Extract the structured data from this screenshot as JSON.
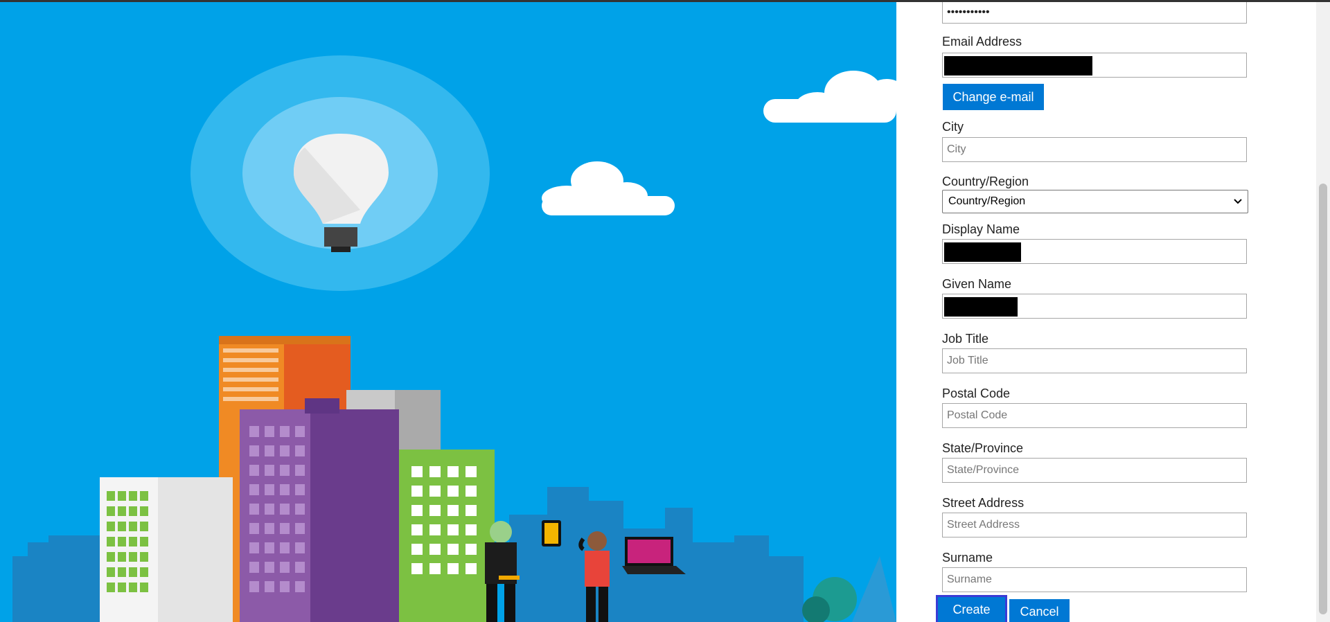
{
  "form": {
    "password_value": "•••••••••••",
    "email_label": "Email Address",
    "change_email_label": "Change e-mail",
    "city_label": "City",
    "city_placeholder": "City",
    "country_label": "Country/Region",
    "country_selected": "Country/Region",
    "display_name_label": "Display Name",
    "given_name_label": "Given Name",
    "job_title_label": "Job Title",
    "job_title_placeholder": "Job Title",
    "postal_code_label": "Postal Code",
    "postal_code_placeholder": "Postal Code",
    "state_label": "State/Province",
    "state_placeholder": "State/Province",
    "street_label": "Street Address",
    "street_placeholder": "Street Address",
    "surname_label": "Surname",
    "surname_placeholder": "Surname",
    "create_label": "Create",
    "cancel_label": "Cancel"
  },
  "colors": {
    "hero_bg": "#00a2e8",
    "primary_button": "#0078d4",
    "focus_outline": "#3b3bd6"
  },
  "icons": {
    "dropdown": "chevron-down-icon"
  }
}
